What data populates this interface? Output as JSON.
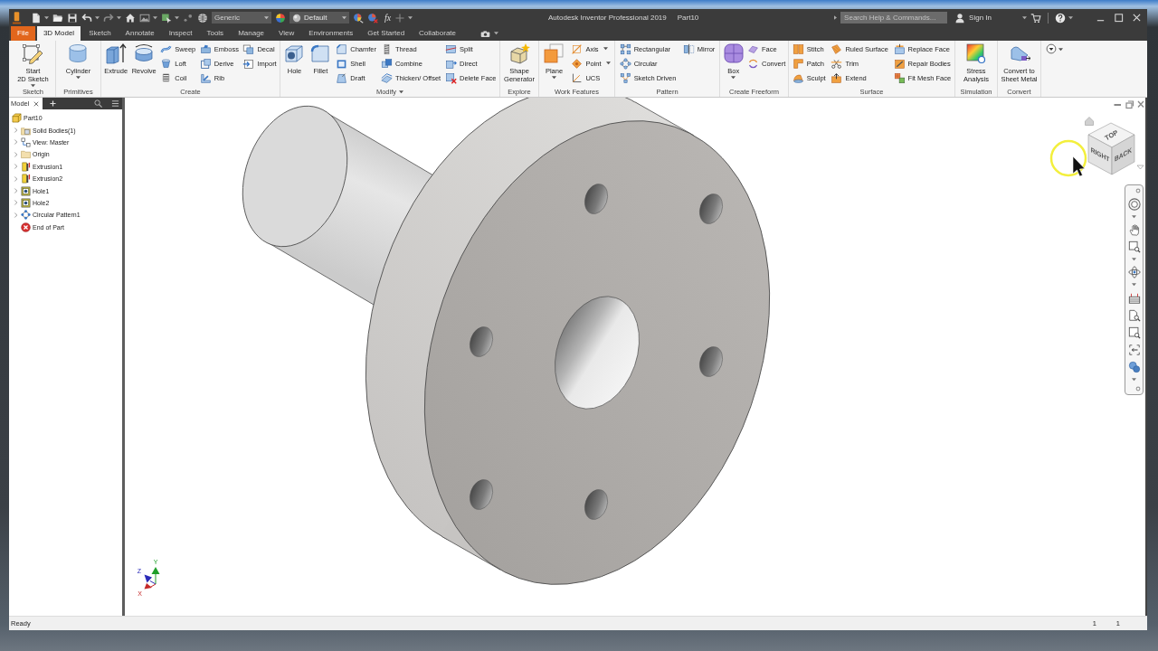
{
  "window": {
    "title": "Autodesk Inventor Professional 2019",
    "document": "Part10"
  },
  "quick_access": {
    "material": "Generic",
    "appearance": "Default",
    "parameters": "fx"
  },
  "search": {
    "placeholder": "Search Help & Commands..."
  },
  "account": {
    "label": "Sign In"
  },
  "tabs": [
    {
      "label": "File",
      "kind": "menu",
      "selected": false
    },
    {
      "label": "3D Model",
      "kind": "tab",
      "selected": true
    },
    {
      "label": "Sketch",
      "kind": "tab",
      "selected": false
    },
    {
      "label": "Annotate",
      "kind": "tab",
      "selected": false
    },
    {
      "label": "Inspect",
      "kind": "tab",
      "selected": false
    },
    {
      "label": "Tools",
      "kind": "tab",
      "selected": false
    },
    {
      "label": "Manage",
      "kind": "tab",
      "selected": false
    },
    {
      "label": "View",
      "kind": "tab",
      "selected": false
    },
    {
      "label": "Environments",
      "kind": "tab",
      "selected": false
    },
    {
      "label": "Get Started",
      "kind": "tab",
      "selected": false
    },
    {
      "label": "Collaborate",
      "kind": "tab",
      "selected": false
    }
  ],
  "ribbon": [
    {
      "title": "Sketch",
      "dropdown": false,
      "items": [
        {
          "kind": "large",
          "label": "Start\n2D Sketch",
          "dropdown": true
        }
      ]
    },
    {
      "title": "Primitives",
      "dropdown": false,
      "items": [
        {
          "kind": "large",
          "label": "Cylinder",
          "dropdown": true
        }
      ]
    },
    {
      "title": "Create",
      "dropdown": false,
      "items": [
        {
          "kind": "large",
          "label": "Extrude",
          "dropdown": false
        },
        {
          "kind": "large",
          "label": "Revolve",
          "dropdown": false
        },
        {
          "kind": "stack",
          "tools": [
            {
              "label": "Sweep",
              "dropdown": false
            },
            {
              "label": "Loft",
              "dropdown": false
            },
            {
              "label": "Coil",
              "dropdown": false
            }
          ]
        },
        {
          "kind": "stack",
          "tools": [
            {
              "label": "Emboss",
              "dropdown": false
            },
            {
              "label": "Derive",
              "dropdown": false
            },
            {
              "label": "Rib",
              "dropdown": false
            }
          ]
        },
        {
          "kind": "stack",
          "tools": [
            {
              "label": "Decal",
              "dropdown": false
            },
            {
              "label": "Import",
              "dropdown": false
            }
          ]
        }
      ]
    },
    {
      "title": "Modify",
      "dropdown": true,
      "items": [
        {
          "kind": "large",
          "label": "Hole",
          "dropdown": false
        },
        {
          "kind": "large",
          "label": "Fillet",
          "dropdown": false
        },
        {
          "kind": "stack",
          "tools": [
            {
              "label": "Chamfer",
              "dropdown": false
            },
            {
              "label": "Shell",
              "dropdown": false
            },
            {
              "label": "Draft",
              "dropdown": false
            }
          ]
        },
        {
          "kind": "stack",
          "tools": [
            {
              "label": "Thread",
              "dropdown": false
            },
            {
              "label": "Combine",
              "dropdown": false
            },
            {
              "label": "Thicken/ Offset",
              "dropdown": false
            }
          ]
        },
        {
          "kind": "stack",
          "tools": [
            {
              "label": "Split",
              "dropdown": false
            },
            {
              "label": "Direct",
              "dropdown": false
            },
            {
              "label": "Delete Face",
              "dropdown": false
            }
          ]
        }
      ]
    },
    {
      "title": "Explore",
      "dropdown": false,
      "items": [
        {
          "kind": "large",
          "label": "Shape\nGenerator",
          "dropdown": false
        }
      ]
    },
    {
      "title": "Work Features",
      "dropdown": false,
      "items": [
        {
          "kind": "large",
          "label": "Plane",
          "dropdown": true
        },
        {
          "kind": "stack",
          "tools": [
            {
              "label": "Axis",
              "dropdown": true
            },
            {
              "label": "Point",
              "dropdown": true
            },
            {
              "label": "UCS",
              "dropdown": false
            }
          ]
        }
      ]
    },
    {
      "title": "Pattern",
      "dropdown": false,
      "items": [
        {
          "kind": "stack",
          "tools": [
            {
              "label": "Rectangular",
              "dropdown": false
            },
            {
              "label": "Circular",
              "dropdown": false
            },
            {
              "label": "Sketch Driven",
              "dropdown": false
            }
          ]
        },
        {
          "kind": "stack",
          "tools": [
            {
              "label": "Mirror",
              "dropdown": false
            }
          ]
        }
      ]
    },
    {
      "title": "Create Freeform",
      "dropdown": false,
      "items": [
        {
          "kind": "large",
          "label": "Box",
          "dropdown": true
        },
        {
          "kind": "stack",
          "tools": [
            {
              "label": "Face",
              "dropdown": false
            },
            {
              "label": "Convert",
              "dropdown": false
            }
          ]
        }
      ]
    },
    {
      "title": "Surface",
      "dropdown": false,
      "items": [
        {
          "kind": "stack",
          "tools": [
            {
              "label": "Stitch",
              "dropdown": false
            },
            {
              "label": "Patch",
              "dropdown": false
            },
            {
              "label": "Sculpt",
              "dropdown": false
            }
          ]
        },
        {
          "kind": "stack",
          "tools": [
            {
              "label": "Ruled Surface",
              "dropdown": false
            },
            {
              "label": "Trim",
              "dropdown": false
            },
            {
              "label": "Extend",
              "dropdown": false
            }
          ]
        },
        {
          "kind": "stack",
          "tools": [
            {
              "label": "Replace Face",
              "dropdown": false
            },
            {
              "label": "Repair Bodies",
              "dropdown": false
            },
            {
              "label": "Fit Mesh Face",
              "dropdown": false
            }
          ]
        }
      ]
    },
    {
      "title": "Simulation",
      "dropdown": false,
      "items": [
        {
          "kind": "large",
          "label": "Stress\nAnalysis",
          "dropdown": false
        }
      ]
    },
    {
      "title": "Convert",
      "dropdown": false,
      "items": [
        {
          "kind": "large",
          "label": "Convert to\nSheet Metal",
          "dropdown": false
        }
      ]
    }
  ],
  "browser": {
    "tab": "Model",
    "tree": [
      {
        "label": "Part10",
        "kind": "part",
        "children": [
          {
            "label": "Solid Bodies(1)",
            "kind": "bodies",
            "expanded": false
          },
          {
            "label": "View: Master",
            "kind": "view",
            "expanded": false
          },
          {
            "label": "Origin",
            "kind": "folder",
            "expanded": false
          },
          {
            "label": "Extrusion1",
            "kind": "extrusion",
            "expanded": false
          },
          {
            "label": "Extrusion2",
            "kind": "extrusion",
            "expanded": false
          },
          {
            "label": "Hole1",
            "kind": "hole",
            "expanded": false
          },
          {
            "label": "Hole2",
            "kind": "hole",
            "expanded": false
          },
          {
            "label": "Circular Pattern1",
            "kind": "pattern",
            "expanded": false
          },
          {
            "label": "End of Part",
            "kind": "end"
          }
        ]
      }
    ]
  },
  "viewcube": {
    "faces": [
      "TOP",
      "RIGHT",
      "BACK"
    ]
  },
  "triad": [
    {
      "label": "Y",
      "color": "#1f9e2a"
    },
    {
      "label": "Z",
      "color": "#2b2bb8"
    },
    {
      "label": "X",
      "color": "#c42a2a"
    }
  ],
  "status_bar": {
    "text": "Ready",
    "counters": [
      "1",
      "1"
    ]
  }
}
